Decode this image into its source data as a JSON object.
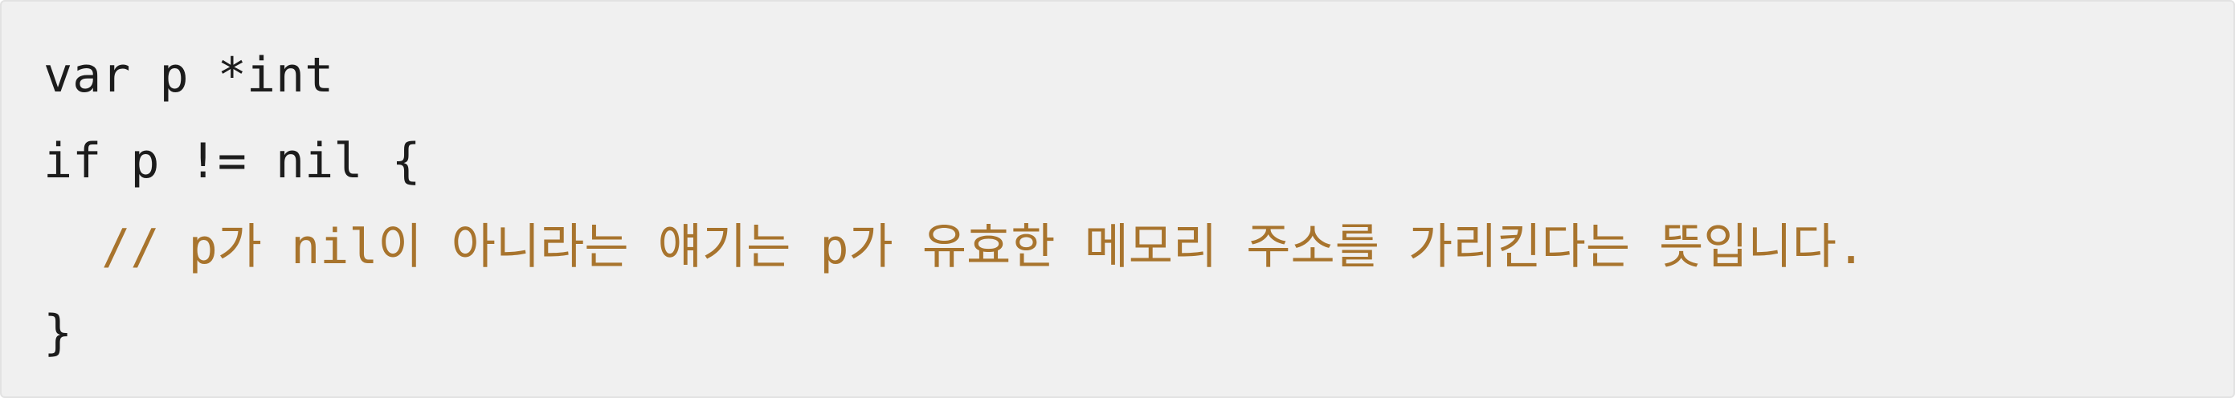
{
  "code_block": {
    "lines": [
      {
        "text": "var p *int"
      },
      {
        "text": "if p != nil {"
      },
      {
        "indent": "  ",
        "text": "// p가 nil이 아니라는 얘기는 p가 유효한 메모리 주소를 가리킨다는 뜻입니다."
      },
      {
        "text": "}"
      }
    ],
    "colors": {
      "background": "#f0f0f0",
      "code_text": "#1c1c1c",
      "comment_text": "#a8742d"
    }
  }
}
